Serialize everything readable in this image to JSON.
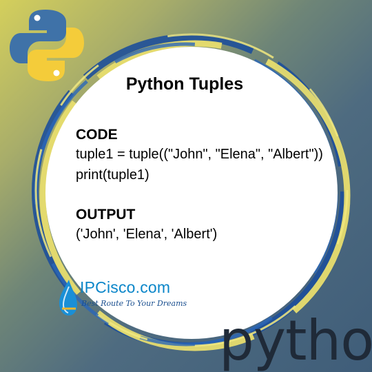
{
  "title": "Python Tuples",
  "code": {
    "heading": "CODE",
    "lines": [
      "tuple1 = tuple((\"John\", \"Elena\", \"Albert\"))",
      "print(tuple1)"
    ]
  },
  "output": {
    "heading": "OUTPUT",
    "line": "('John', 'Elena', 'Albert')"
  },
  "brand": {
    "name": "IPCisco.com",
    "tagline": "Best Route To Your Dreams"
  },
  "python_word": "python",
  "colors": {
    "python_blue": "#3f72a8",
    "python_yellow": "#f4cc3a",
    "brand_blue": "#0b86c9",
    "circle": "#ffffff"
  },
  "icons": [
    "python-logo-icon",
    "water-drop-icon"
  ]
}
